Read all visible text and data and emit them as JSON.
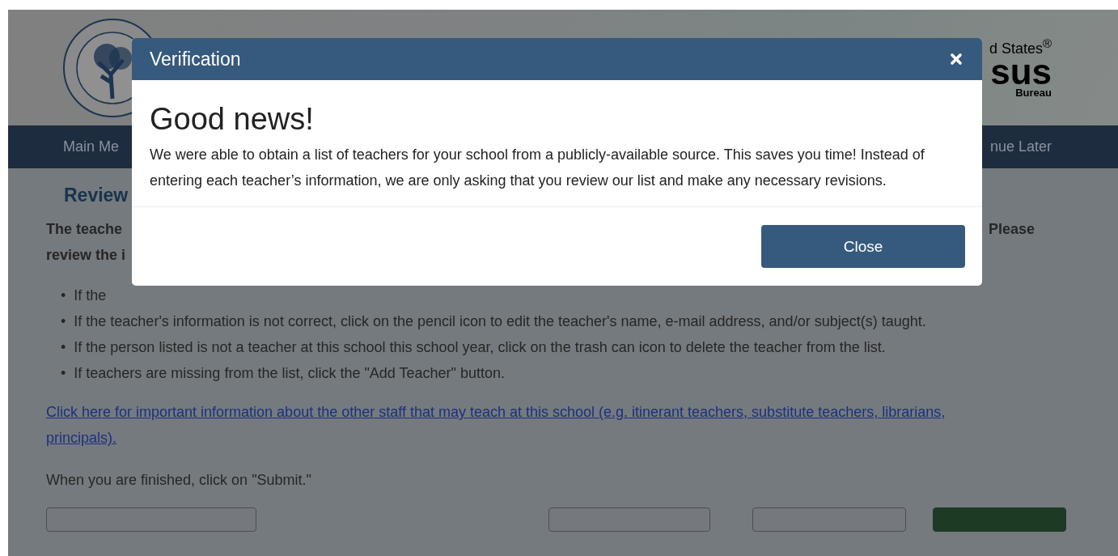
{
  "header": {
    "census_logo": [
      "d States$^{®}$",
      "sus",
      "Bureau"
    ]
  },
  "nav": {
    "items": [
      "Main Me",
      "nue Later"
    ]
  },
  "page": {
    "heading": "Review",
    "intro_left": [
      "The teache",
      "review the i"
    ],
    "intro_right": "Please",
    "bullets": [
      {
        "marker": "•",
        "text": "If the"
      },
      {
        "marker": "•",
        "text": "If the teacher's information is not correct, click on the pencil icon to edit the teacher's name, e-mail address, and/or subject(s) taught."
      },
      {
        "marker": "•",
        "text": "If the person listed is not a teacher at this school this school year, click on the trash can icon to delete the teacher from the list."
      },
      {
        "marker": "•",
        "text": "If teachers are missing from the list, click the \"Add Teacher\" button."
      }
    ],
    "link": "Click here for important information about the other staff that may teach at this school (e.g. itinerant teachers, substitute teachers, librarians, principals).",
    "note": "When you are finished, click on \"Submit.\"",
    "buttons": [
      {
        "kind": "outline"
      },
      {
        "kind": "outline"
      },
      {
        "kind": "outline"
      },
      {
        "kind": "primary"
      }
    ]
  },
  "modal": {
    "title": "Verification",
    "heading": "Good news!",
    "body": "We were able to obtain a list of teachers for your school from a publicly-available source. This saves you time! Instead of entering each teacher’s information, we are only asking that you review our list and make any necessary revisions.",
    "button": "Close"
  }
}
